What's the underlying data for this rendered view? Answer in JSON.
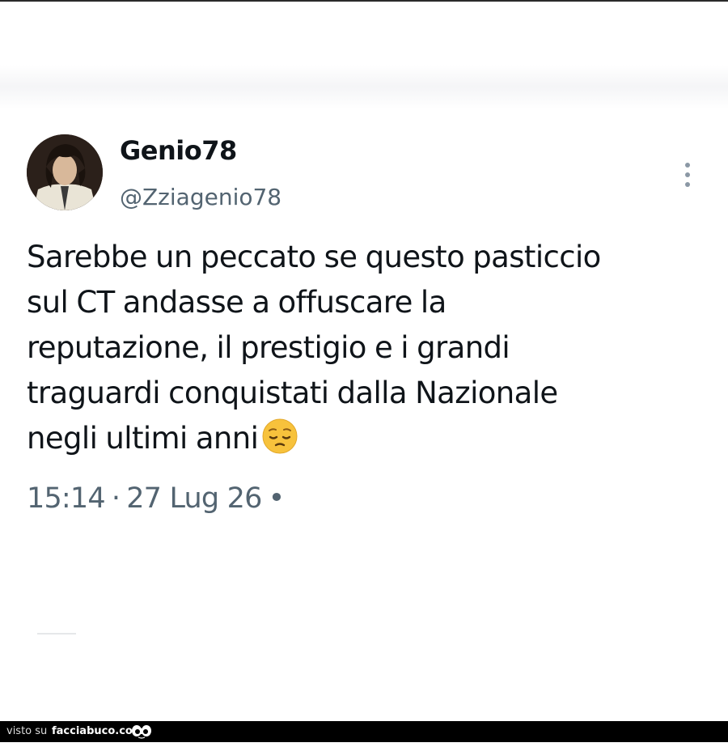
{
  "tweet": {
    "display_name": "Genio78",
    "handle": "@Zziagenio78",
    "text_lines": [
      "Sarebbe un peccato se questo pasticcio",
      "sul CT andasse a offuscare la",
      "reputazione, il prestigio e i grandi",
      "traguardi conquistati dalla Nazionale",
      "negli ultimi anni"
    ],
    "emoji": "pensive-face",
    "time": "15:14",
    "separator": "·",
    "date": "27 Lug 26",
    "trailing_separator": "•"
  },
  "icons": {
    "more": "vertical-ellipsis-icon",
    "avatar": "user-avatar"
  },
  "footer": {
    "prefix": "visto su",
    "site": "facciabuco.com"
  },
  "colors": {
    "text_primary": "#0f1419",
    "text_secondary": "#536471",
    "footer_bg": "#000000",
    "emoji_yellow": "#f7c23c"
  }
}
